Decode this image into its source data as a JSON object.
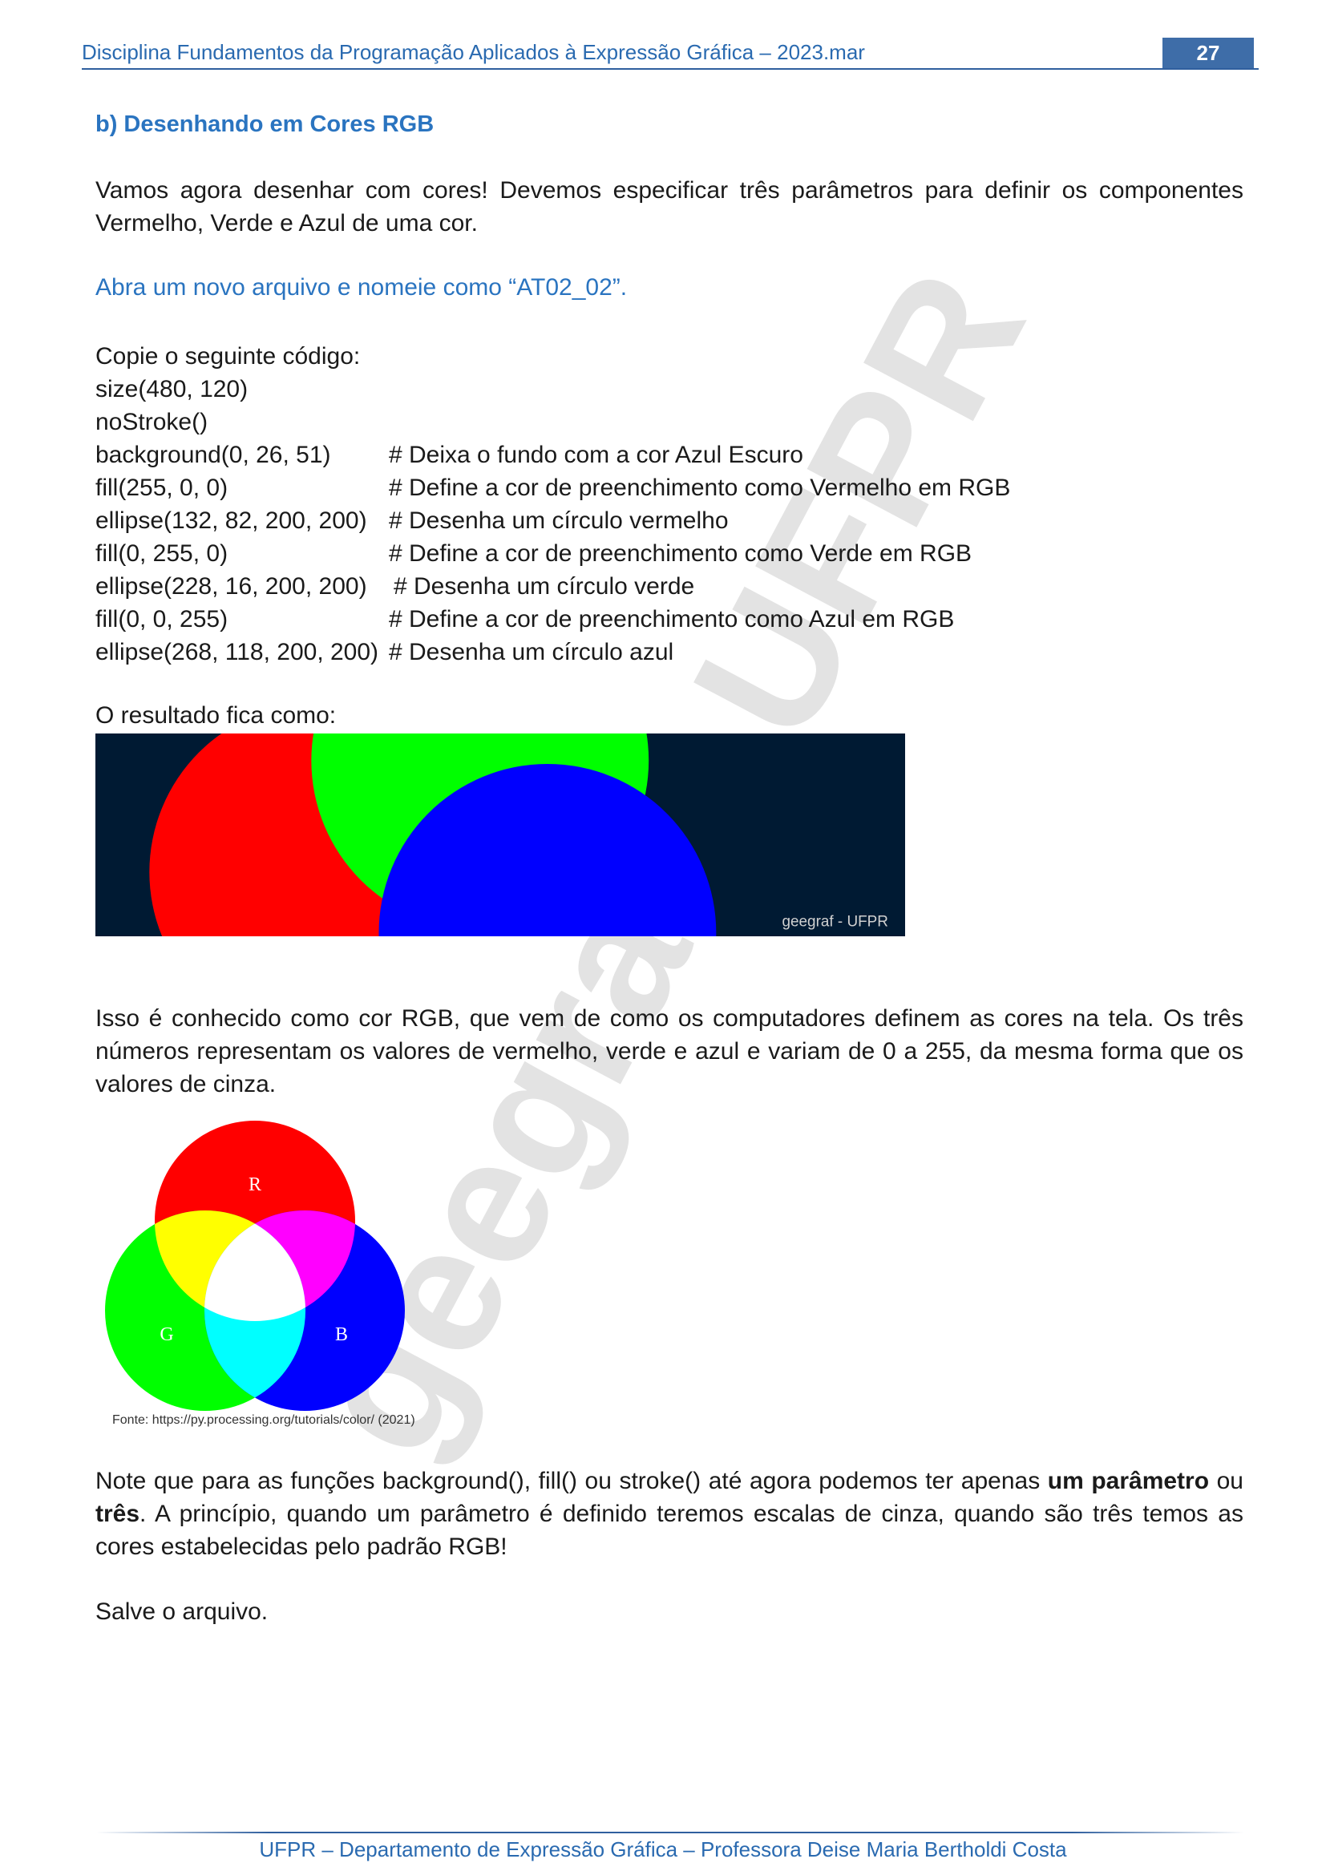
{
  "header": {
    "title": "Disciplina Fundamentos da Programação Aplicados à Expressão Gráfica – 2023.mar",
    "page_number": "27"
  },
  "section_title": "b) Desenhando em Cores RGB",
  "intro_paragraph": "Vamos agora desenhar com cores! Devemos especificar três parâmetros para definir os componentes Vermelho, Verde e Azul de uma cor.",
  "instruction": "Abra um novo arquivo e nomeie como “AT02_02”.",
  "code_intro": "Copie o seguinte código:",
  "code_lines": [
    {
      "code": "size(480, 120)",
      "comment": ""
    },
    {
      "code": "noStroke()",
      "comment": ""
    },
    {
      "code": "background(0, 26, 51)",
      "comment": "# Deixa o fundo com a cor Azul Escuro"
    },
    {
      "code": "fill(255, 0, 0)",
      "comment": "# Define a cor de preenchimento como Vermelho em RGB"
    },
    {
      "code": "ellipse(132, 82, 200, 200)",
      "comment": "# Desenha um círculo vermelho"
    },
    {
      "code": "fill(0, 255, 0)",
      "comment": "# Define a cor de preenchimento como Verde em RGB"
    },
    {
      "code": "ellipse(228, 16, 200, 200)",
      "comment": "# Desenha um círculo verde"
    },
    {
      "code": "fill(0, 0, 255)",
      "comment": "# Define a cor de preenchimento como Azul em RGB"
    },
    {
      "code": "ellipse(268, 118, 200, 200)",
      "comment": "# Desenha um círculo azul"
    }
  ],
  "result_label": "O resultado fica como:",
  "result_image": {
    "watermark": "geegraf - UFPR",
    "background_color": "#001a33"
  },
  "explanation_paragraph": "Isso é conhecido como cor RGB, que vem de como os computadores definem as cores na tela. Os três números representam os valores de vermelho, verde e azul e variam de 0 a 255, da mesma forma que os valores de cinza.",
  "rgb_diagram": {
    "label_r": "R",
    "label_g": "G",
    "label_b": "B"
  },
  "rgb_caption": "Fonte: https://py.processing.org/tutorials/color/ (2021)",
  "note": {
    "part1": "Note que para as funções background(), fill() ou stroke() até agora podemos ter apenas ",
    "bold1": "um parâmetro",
    "part2": " ou ",
    "bold2": "três",
    "part3": ". A princípio, quando um parâmetro é definido teremos escalas de cinza, quando são três temos as cores estabelecidas pelo padrão RGB!"
  },
  "save_note": "Salve o arquivo.",
  "footer": "UFPR – Departamento de Expressão Gráfica – Professora Deise Maria Bertholdi Costa",
  "page_watermark": "geegraf - UFPR"
}
